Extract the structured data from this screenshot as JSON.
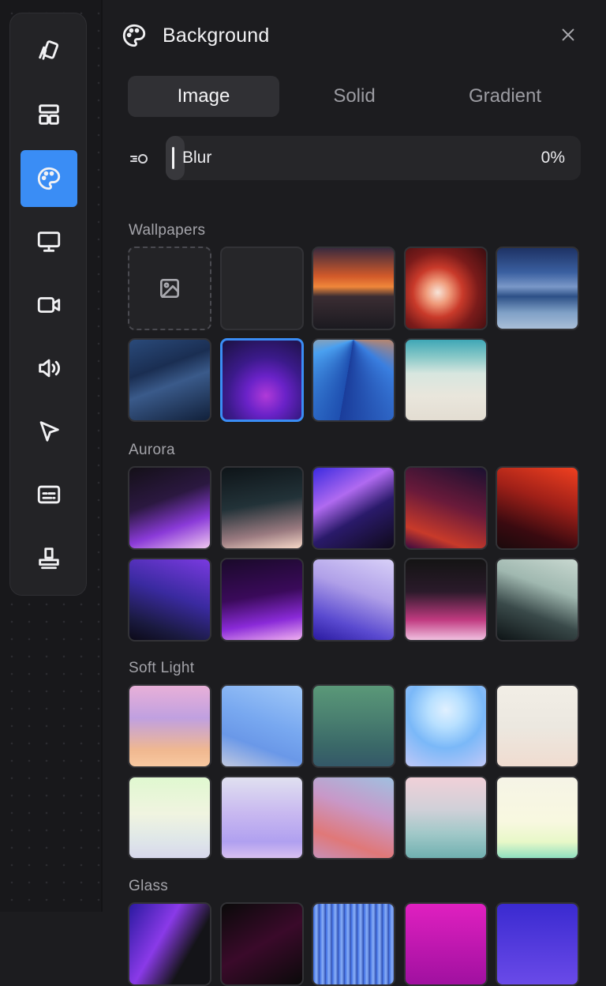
{
  "panel": {
    "title": "Background",
    "close_icon": "close-icon",
    "header_icon": "palette-icon"
  },
  "sidebar": {
    "items": [
      {
        "name": "sidebar-item-wallpaper",
        "icon": "cards-icon",
        "active": false
      },
      {
        "name": "sidebar-item-layout",
        "icon": "layout-icon",
        "active": false
      },
      {
        "name": "sidebar-item-background",
        "icon": "palette-icon",
        "active": true
      },
      {
        "name": "sidebar-item-screen",
        "icon": "monitor-icon",
        "active": false
      },
      {
        "name": "sidebar-item-camera",
        "icon": "video-camera-icon",
        "active": false
      },
      {
        "name": "sidebar-item-audio",
        "icon": "speaker-icon",
        "active": false
      },
      {
        "name": "sidebar-item-cursor",
        "icon": "cursor-icon",
        "active": false
      },
      {
        "name": "sidebar-item-captions",
        "icon": "captions-icon",
        "active": false
      },
      {
        "name": "sidebar-item-watermark",
        "icon": "stamp-icon",
        "active": false
      }
    ],
    "accent_color": "#3a8df5"
  },
  "tabs": [
    {
      "label": "Image",
      "active": true
    },
    {
      "label": "Solid",
      "active": false
    },
    {
      "label": "Gradient",
      "active": false
    }
  ],
  "blur": {
    "label": "Blur",
    "value_text": "0%",
    "value": 0
  },
  "sections": {
    "wallpapers": {
      "title": "Wallpapers",
      "tiles": [
        {
          "kind": "upload",
          "icon": "image-icon"
        },
        {
          "kind": "empty"
        },
        {
          "kind": "image",
          "bg": "linear-gradient(180deg,#3a2a3e 0%,#d25a2a 35%,#f0873a 48%,#3b2d33 60%,#1b1a20 100%)"
        },
        {
          "kind": "image",
          "bg": "radial-gradient(circle at 40% 55%,#f7e4d8 0%,#ef9a7a 18%,#c93a2a 38%,#7a1b1a 62%,#3a0d10 100%)"
        },
        {
          "kind": "image",
          "bg": "linear-gradient(180deg,#1e3264 0%,#3a5fa0 30%,#7a98c8 48%,#2d5087 60%,#7fa0c6 80%,#a9bed8 100%)"
        },
        {
          "kind": "image",
          "bg": "linear-gradient(160deg,#2a4a7a 0%,#1a2e52 35%,#3a5a8a 55%,#11203a 100%)"
        },
        {
          "kind": "image",
          "selected": true,
          "bg": "radial-gradient(circle at 55% 70%,#b03ad8 0%,#6a22c8 28%,#3b1a8a 55%,#1a1240 100%)"
        },
        {
          "kind": "image",
          "bg": "conic-gradient(from 190deg at 50% 0%,#1e4fb0,#4aa0f0,#f3a45a,#fde2b0,#f38a3a,#3a7fe0,#1a3c9a)"
        },
        {
          "kind": "image",
          "bg": "linear-gradient(180deg,#3fa7b6 0%,#8ac9c8 22%,#d7e6df 42%,#e9e6dc 70%,#e3ddd2 100%)"
        }
      ]
    },
    "aurora": {
      "title": "Aurora",
      "tiles": [
        {
          "bg": "linear-gradient(160deg,#141018 0%,#2b1840 40%,#8a3ad8 70%,#f0c8f0 100%)"
        },
        {
          "bg": "linear-gradient(170deg,#0e1418 0%,#223238 45%,#9a7a80 78%,#f6d8c8 100%)"
        },
        {
          "bg": "linear-gradient(150deg,#3a2ae0 0%,#b06af0 35%,#2a1a6a 60%,#0f0a1a 100%)"
        },
        {
          "bg": "linear-gradient(200deg,#1a1030 0%,#6a1a3a 45%,#c83a2a 80%,#3a0a40 100%)"
        },
        {
          "bg": "linear-gradient(200deg,#f04020 0%,#a02018 40%,#3a0a10 75%,#1a0a0c 100%)"
        },
        {
          "bg": "linear-gradient(200deg,#7a3ae0 0%,#3a2aa0 45%,#1a1a40 80%,#0c0a18 100%)"
        },
        {
          "bg": "linear-gradient(170deg,#1a0a2a 0%,#3a0a5a 45%,#8a2ad8 75%,#f0b0f0 100%)"
        },
        {
          "bg": "linear-gradient(200deg,#d8d0f8 0%,#b0a0e8 40%,#5a4ad0 75%,#2a1aa0 100%)"
        },
        {
          "bg": "linear-gradient(180deg,#141414 0%,#2a1a2a 40%,#c03a80 75%,#f0c0e0 100%)"
        },
        {
          "bg": "linear-gradient(200deg,#c8d8d0 0%,#a0b8b0 35%,#3a4a4a 65%,#0e1416 100%)"
        }
      ]
    },
    "soft_light": {
      "title": "Soft Light",
      "tiles": [
        {
          "bg": "linear-gradient(180deg,#e8b0d8 0%,#c0a0e0 40%,#f0b890 80%,#f8c8a0 100%)"
        },
        {
          "bg": "linear-gradient(200deg,#a0c8f8 0%,#78a8f0 45%,#6a98e8 70%,#c0c8e0 100%)"
        },
        {
          "bg": "linear-gradient(180deg,#5a9878 0%,#4a8070 40%,#3a6868 75%,#345868 100%)"
        },
        {
          "bg": "radial-gradient(circle at 50% 30%,#e0f0ff 0%,#b8e0ff 25%,#7ab8f8 55%,#c0c8f8 100%)"
        },
        {
          "bg": "linear-gradient(180deg,#f2eee6 0%,#ece8e0 50%,#f0dcd0 100%)"
        },
        {
          "bg": "linear-gradient(180deg,#e0f8d0 0%,#f0f4e0 45%,#e0e8e8 75%,#d8d8ec 100%)"
        },
        {
          "bg": "linear-gradient(180deg,#e0e0f0 0%,#c8b8f0 45%,#b0a0f0 80%,#d8c0f0 100%)"
        },
        {
          "bg": "linear-gradient(200deg,#a0c0e0 0%,#c898c8 40%,#e07878 75%,#c890b8 100%)"
        },
        {
          "bg": "linear-gradient(180deg,#f0d0d8 0%,#d0d0d8 40%,#a0c8c8 70%,#70b0b0 100%)"
        },
        {
          "bg": "linear-gradient(180deg,#f6f4e6 0%,#f8f8e0 55%,#e8f8c8 80%,#90e0c0 100%)"
        }
      ]
    },
    "glass": {
      "title": "Glass",
      "tiles": [
        {
          "bg": "linear-gradient(120deg,#2a1aa0 0%,#8a3ae8 40%,#141418 70%)"
        },
        {
          "bg": "linear-gradient(150deg,#0a0a0a 0%,#3a0a2a 50%,#0a0a0a 100%)"
        },
        {
          "bg": "repeating-linear-gradient(90deg,#3a6ae0 0px,#8ab0f8 4px,#2a4ab0 8px)"
        },
        {
          "bg": "linear-gradient(180deg,#e020c0 0%,#a010a0 100%)"
        },
        {
          "bg": "linear-gradient(180deg,#3a2ad0 0%,#6a4ae8 100%)"
        }
      ]
    }
  }
}
